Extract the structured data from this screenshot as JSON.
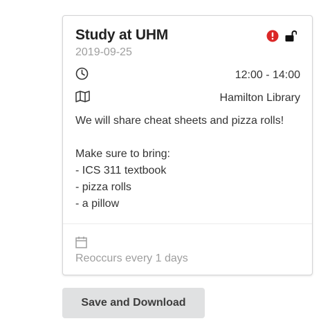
{
  "event": {
    "title": "Study at UHM",
    "date": "2019-09-25",
    "time": "12:00 - 14:00",
    "location": "Hamilton Library",
    "description": [
      "We will share cheat sheets and pizza rolls!",
      "",
      "Make sure to bring:",
      "- ICS 311 textbook",
      "- pizza rolls",
      "- a pillow"
    ],
    "recurrence": "Reoccurs every 1 days",
    "icons": {
      "alert": "exclamation-circle-icon",
      "lock": "unlocked-lock-icon",
      "time": "clock-icon",
      "location": "map-icon",
      "recurrence": "calendar-icon"
    },
    "colors": {
      "alert": "#db2828",
      "muted": "#9e9e9e",
      "button_bg": "#e0e1e2"
    }
  },
  "actions": {
    "save_label": "Save and Download"
  }
}
